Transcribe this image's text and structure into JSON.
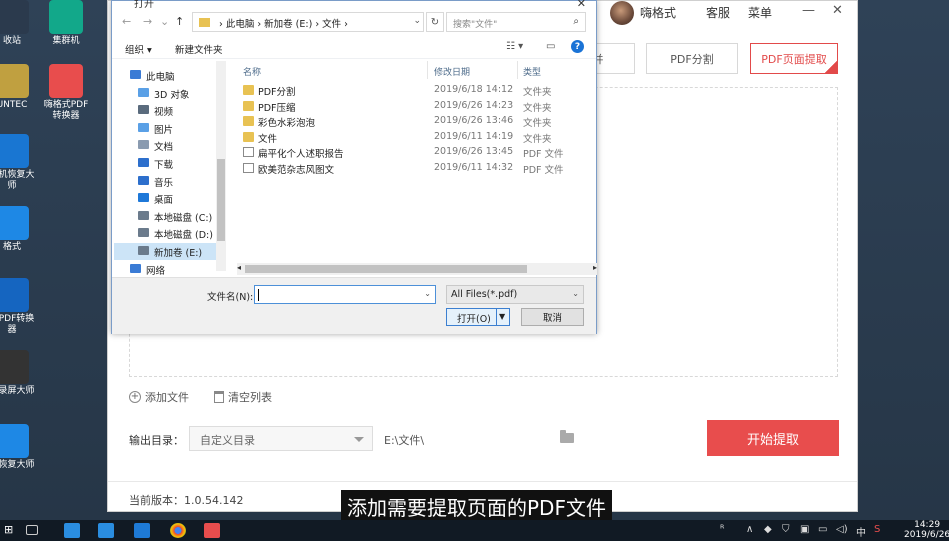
{
  "desktop": {
    "icons": [
      {
        "label": "收站",
        "color": "#2b3a4d"
      },
      {
        "label": "集群机",
        "color": "#12a88a"
      },
      {
        "label": "UNTEC",
        "color": "#c0a040"
      },
      {
        "label": "嗨格式PDF转换器",
        "color": "#e84d4d"
      },
      {
        "label": "手机恢复大师",
        "color": "#1976d2"
      },
      {
        "label": "格式",
        "color": "#1e88e5"
      },
      {
        "label": "式PDF转换器",
        "color": "#1565c0"
      },
      {
        "label": "式录屏大师",
        "color": "#333333"
      },
      {
        "label": "据恢复大师",
        "color": "#1e88e5"
      }
    ]
  },
  "app": {
    "user_name": "嗨格式",
    "service": "客服",
    "menu": "菜单",
    "tabs": [
      "并",
      "PDF分割",
      "PDF页面提取"
    ],
    "add_file": "添加文件",
    "clear_list": "清空列表",
    "output_label": "输出目录：",
    "output_select": "自定义目录",
    "output_path": "E:\\文件\\",
    "start_button": "开始提取",
    "version": "当前版本：1.0.54.142",
    "accent": "#e84d4d"
  },
  "dialog": {
    "title": "打开",
    "breadcrumb": "› 此电脑 › 新加卷 (E:) › 文件 ›",
    "search_placeholder": "搜索\"文件\"",
    "organize": "组织 ▾",
    "new_folder": "新建文件夹",
    "tree": [
      {
        "label": "此电脑",
        "color": "#3a7bd5"
      },
      {
        "label": "3D 对象",
        "color": "#5aa0e6"
      },
      {
        "label": "视频",
        "color": "#5a6b7d"
      },
      {
        "label": "图片",
        "color": "#5aa0e6"
      },
      {
        "label": "文档",
        "color": "#8a9bb0"
      },
      {
        "label": "下载",
        "color": "#2d6fcc"
      },
      {
        "label": "音乐",
        "color": "#2d6fcc"
      },
      {
        "label": "桌面",
        "color": "#1e78d8"
      },
      {
        "label": "本地磁盘 (C:)",
        "color": "#6b7b8c"
      },
      {
        "label": "本地磁盘 (D:)",
        "color": "#6b7b8c"
      },
      {
        "label": "新加卷 (E:)",
        "color": "#6b7b8c"
      },
      {
        "label": "网络",
        "color": "#3a7bd5"
      }
    ],
    "columns": {
      "name": "名称",
      "date": "修改日期",
      "type": "类型"
    },
    "files": [
      {
        "name": "PDF分割",
        "date": "2019/6/18 14:12",
        "type": "文件夹",
        "kind": "folder"
      },
      {
        "name": "PDF压缩",
        "date": "2019/6/26 14:23",
        "type": "文件夹",
        "kind": "folder"
      },
      {
        "name": "彩色水彩泡泡",
        "date": "2019/6/26 13:46",
        "type": "文件夹",
        "kind": "folder"
      },
      {
        "name": "文件",
        "date": "2019/6/11 14:19",
        "type": "文件夹",
        "kind": "folder"
      },
      {
        "name": "扁平化个人述职报告",
        "date": "2019/6/26 13:45",
        "type": "PDF 文件",
        "kind": "pdf"
      },
      {
        "name": "欧美范杂志风图文",
        "date": "2019/6/11 14:32",
        "type": "PDF 文件",
        "kind": "pdf"
      }
    ],
    "filename_label": "文件名(N):",
    "filename_value": "",
    "filetype": "All Files(*.pdf)",
    "open_button": "打开(O)",
    "cancel_button": "取消"
  },
  "subtitle": "添加需要提取页面的PDF文件",
  "taskbar": {
    "input_lang": "中",
    "time": "14:29",
    "date": "2019/6/26"
  }
}
